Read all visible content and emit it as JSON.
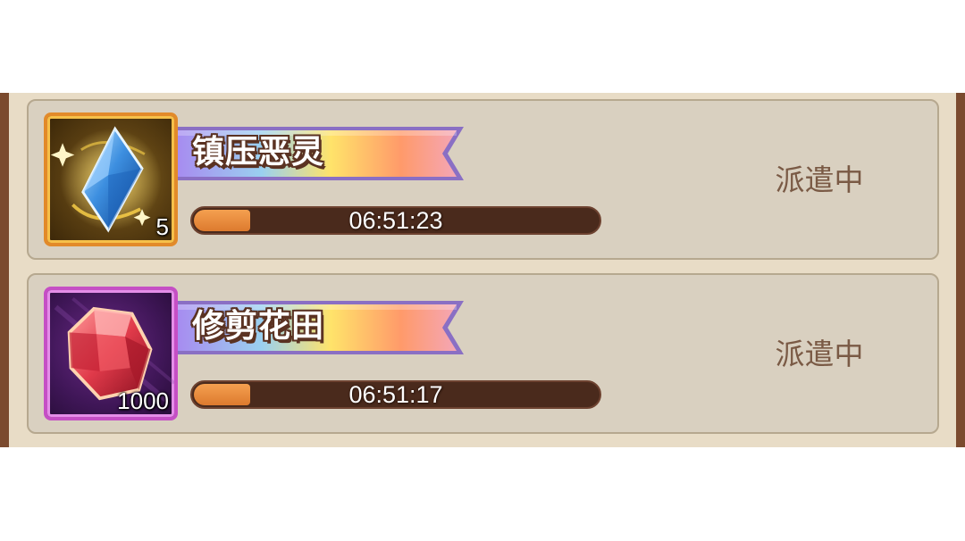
{
  "missions": [
    {
      "title": "镇压恶灵",
      "item_icon": "blue-crystal-icon",
      "item_count": "5",
      "timer": "06:51:23",
      "progress": 0.14,
      "status": "派遣中",
      "frame_color": "#e28a2a"
    },
    {
      "title": "修剪花田",
      "item_icon": "red-gem-icon",
      "item_count": "1000",
      "timer": "06:51:17",
      "progress": 0.14,
      "status": "派遣中",
      "frame_color": "#c54fc5"
    }
  ],
  "colors": {
    "panel_bg": "#e8dcc6",
    "card_bg": "#d9d0c0",
    "panel_border": "#7b4a2e",
    "progress_fill": "#dd7a2e",
    "progress_track": "#4a2a1c",
    "status_text": "#7a5a45"
  }
}
